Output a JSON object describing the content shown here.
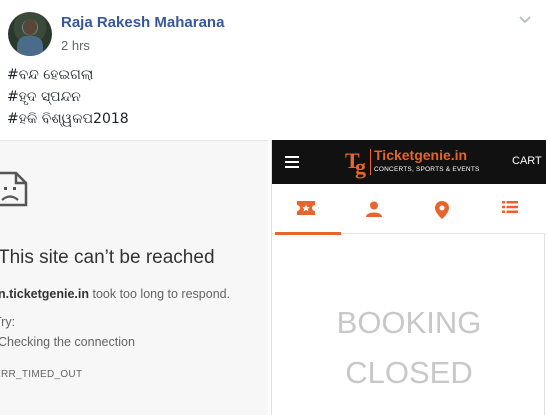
{
  "post": {
    "author": "Raja Rakesh Maharana",
    "timestamp": "2 hrs",
    "hashtags": [
      "#ବନ୍ଦ ହେଇଗଲା",
      "#ହୃଦ ସ୍ପନ୍ଦନ",
      "#ହକି ବିଶ୍ୱକପ2018"
    ]
  },
  "error_page": {
    "title": "This site can’t be reached",
    "domain": "n.ticketgenie.in",
    "detail_suffix": " took too long to respond.",
    "try_label": "Try:",
    "try_item": "Checking the connection",
    "error_code": "ERR_TIMED_OUT"
  },
  "ticketgenie": {
    "brand": "Ticketgenie.in",
    "tagline": "CONCERTS, SPORTS & EVENTS",
    "cart_label": "CART",
    "tabs": [
      "ticket-icon",
      "user-icon",
      "location-icon",
      "list-icon"
    ],
    "accent_color": "#e8642c",
    "status_line1": "BOOKING",
    "status_line2": "CLOSED"
  }
}
